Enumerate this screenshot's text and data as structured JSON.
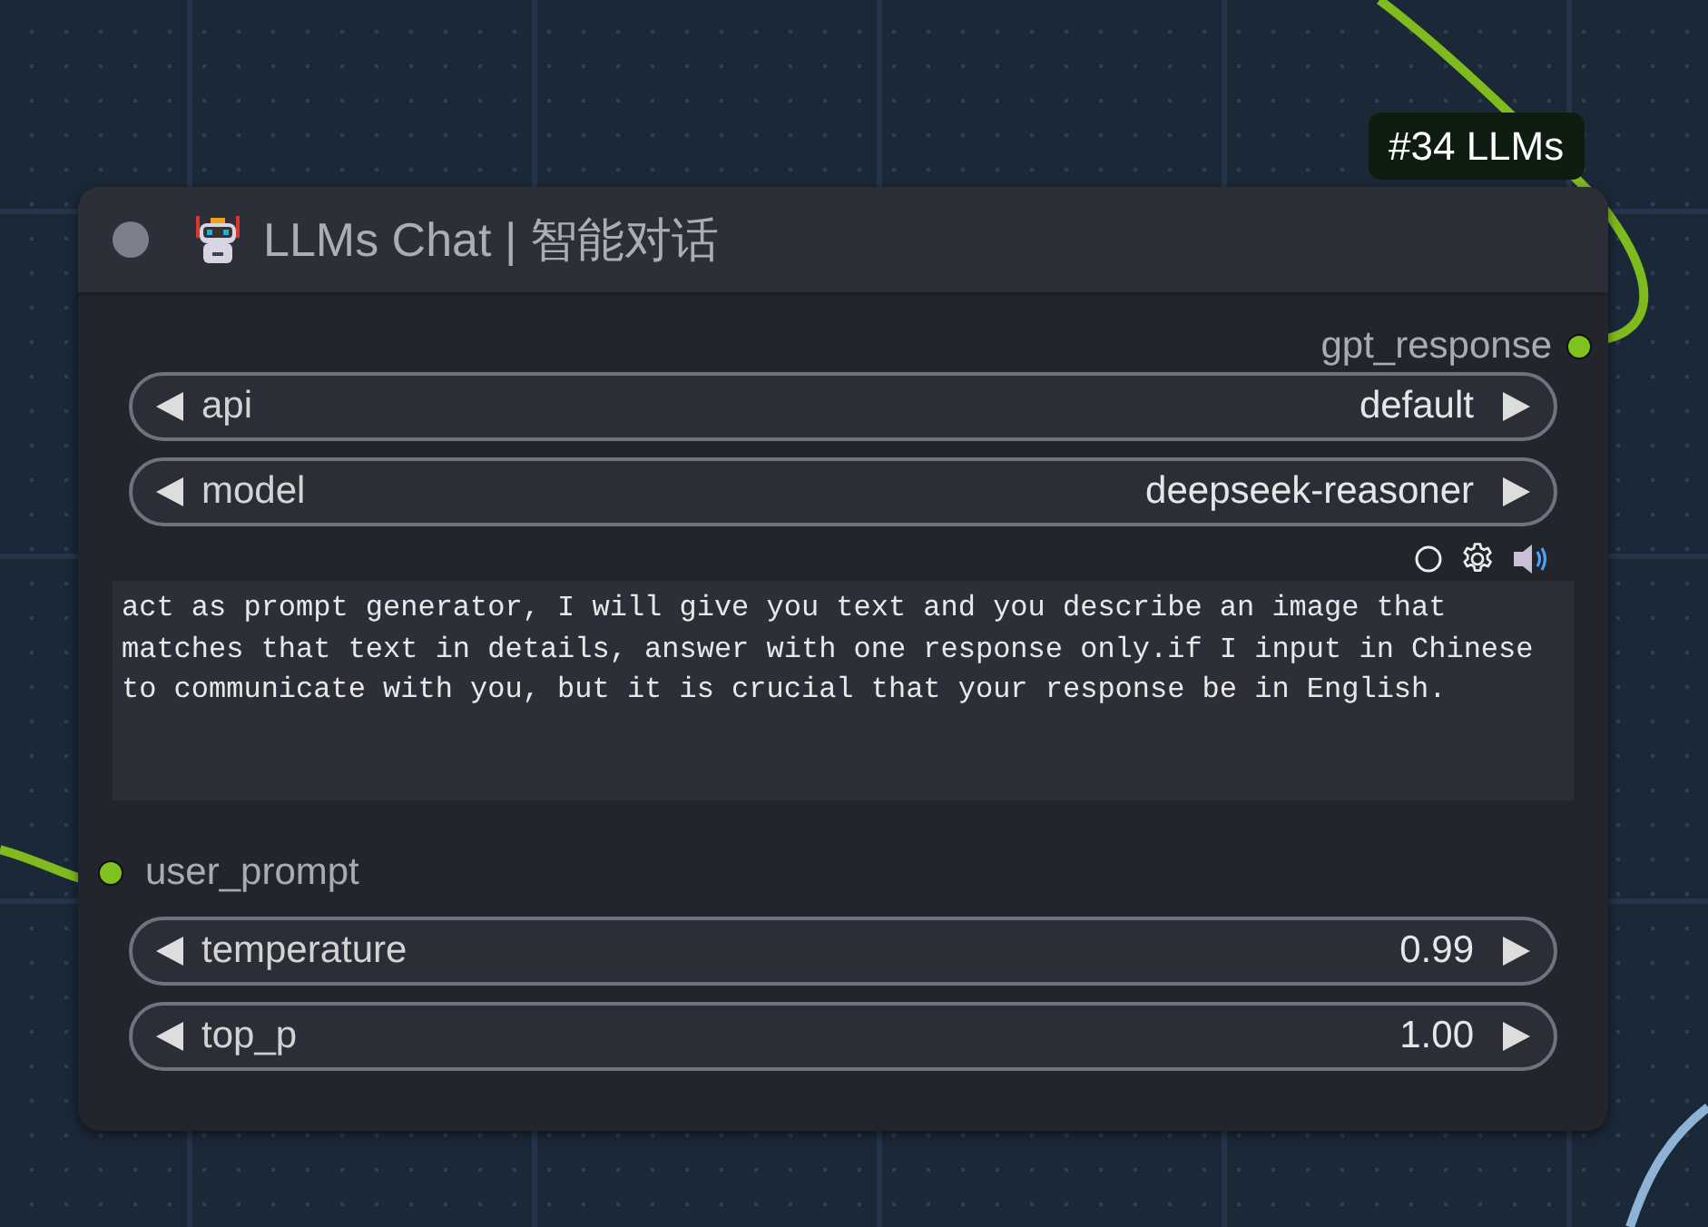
{
  "node": {
    "badge": "#34 LLMs",
    "title": "LLMs Chat | 智能对话",
    "collapsed": false,
    "outputs": [
      {
        "name": "gpt_response",
        "connected": true
      }
    ],
    "widgets_top": [
      {
        "label": "api",
        "value": "default"
      },
      {
        "label": "model",
        "value": "deepseek-reasoner"
      }
    ],
    "prompt": "act as prompt generator, I will give you text and you describe an image that matches that text in details, answer with one response only.if I input in Chinese to communicate with you, but it is crucial that your response be in English.",
    "inputs": [
      {
        "name": "user_prompt",
        "connected": true
      }
    ],
    "widgets_bottom": [
      {
        "label": "temperature",
        "value": "0.99"
      },
      {
        "label": "top_p",
        "value": "1.00"
      }
    ]
  }
}
